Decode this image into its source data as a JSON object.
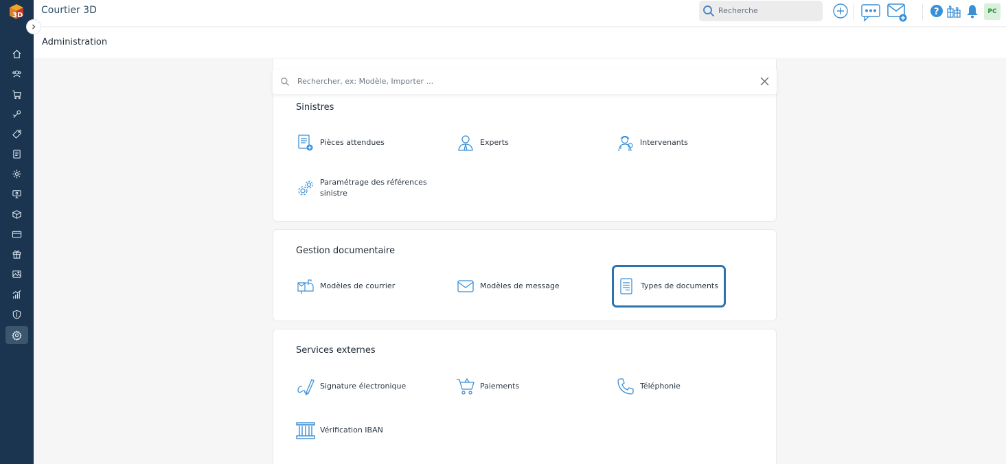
{
  "app": {
    "title": "Courtier 3D"
  },
  "header": {
    "search_placeholder": "Recherche",
    "avatar_initials": "PC"
  },
  "page": {
    "title": "Administration"
  },
  "settings_search": {
    "placeholder": "Rechercher, ex: Modèle, Importer ..."
  },
  "sections": {
    "sinistres": {
      "title": "Sinistres",
      "items": [
        "Pièces attendues",
        "Experts",
        "Intervenants",
        "Paramétrage des références sinistre"
      ]
    },
    "gestion": {
      "title": "Gestion documentaire",
      "items": [
        "Modèles de courrier",
        "Modèles de message",
        "Types de documents"
      ]
    },
    "services": {
      "title": "Services externes",
      "items": [
        "Signature électronique",
        "Paiements",
        "Téléphonie",
        "Vérification IBAN"
      ]
    }
  },
  "colors": {
    "sidebar": "#1b3550",
    "accent": "#2d73b2",
    "icon_blue": "#3a8fd6"
  }
}
